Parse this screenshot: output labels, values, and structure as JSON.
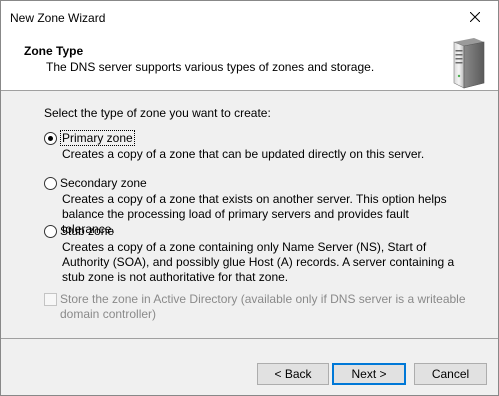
{
  "window": {
    "title": "New Zone Wizard"
  },
  "header": {
    "title": "Zone Type",
    "subtitle": "The DNS server supports various types of zones and storage."
  },
  "body": {
    "prompt": "Select the type of zone you want to create:",
    "options": [
      {
        "label": "Primary zone",
        "selected": true,
        "description": "Creates a copy of a zone that can be updated directly on this server."
      },
      {
        "label": "Secondary zone",
        "selected": false,
        "description": "Creates a copy of a zone that exists on another server. This option helps balance the processing load of primary servers and provides fault tolerance."
      },
      {
        "label": "Stub zone",
        "selected": false,
        "description": "Creates a copy of a zone containing only Name Server (NS), Start of Authority (SOA), and possibly glue Host (A) records. A server containing a stub zone is not authoritative for that zone."
      }
    ],
    "ad_checkbox": {
      "label": "Store the zone in Active Directory (available only if DNS server is a writeable domain controller)",
      "checked": false,
      "enabled": false
    }
  },
  "buttons": {
    "back": "< Back",
    "next": "Next >",
    "cancel": "Cancel"
  },
  "icons": {
    "close": "close-icon",
    "server": "server-icon"
  },
  "colors": {
    "accent": "#0078d7",
    "disabled_text": "#8a8a8a"
  }
}
